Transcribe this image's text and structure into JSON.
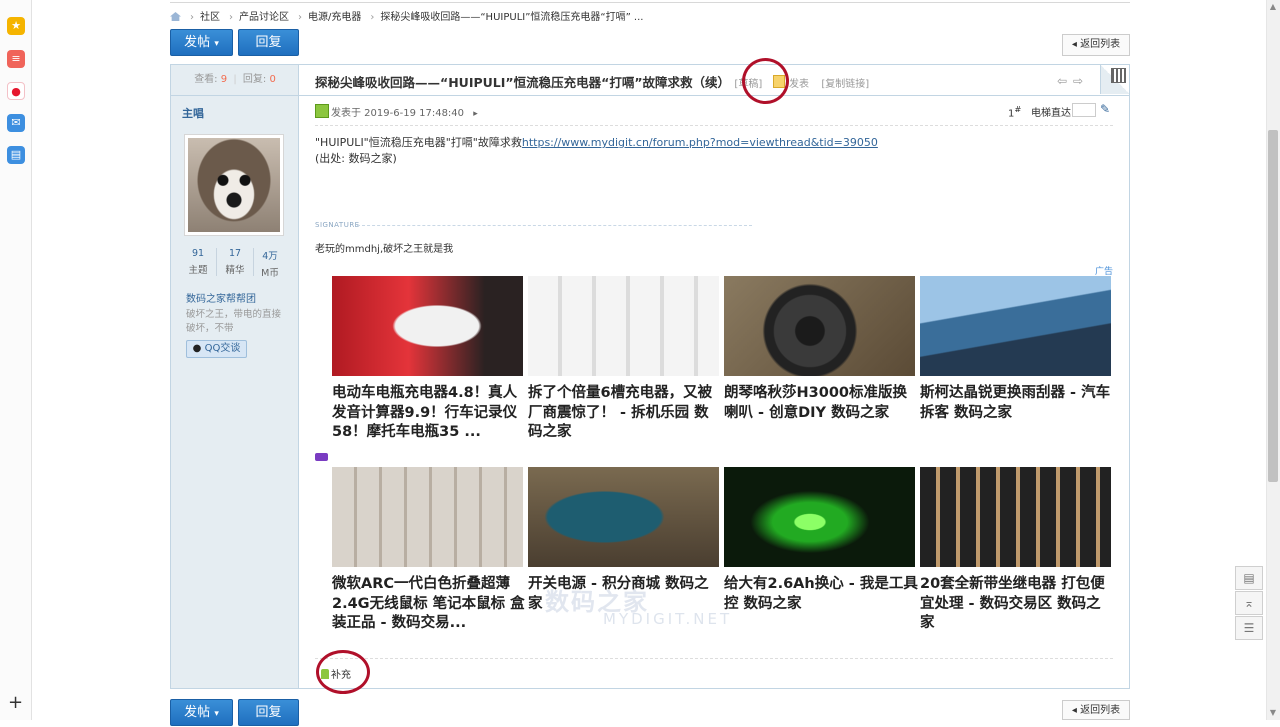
{
  "browser_sidebar": {
    "icons": [
      {
        "name": "favorites-star-icon",
        "color": "#f5b400",
        "glyph": "★"
      },
      {
        "name": "notes-icon",
        "color": "#f0645a",
        "glyph": "≡"
      },
      {
        "name": "weibo-icon",
        "color": "#e6162d",
        "glyph": "●"
      },
      {
        "name": "mail-icon",
        "color": "#3d8fe0",
        "glyph": "✉"
      },
      {
        "name": "document-icon",
        "color": "#3d8fe0",
        "glyph": "▤"
      }
    ],
    "add_glyph": "+"
  },
  "breadcrumb": {
    "items": [
      "社区",
      "产品讨论区",
      "电源/充电器",
      "探秘尖峰吸收回路——“HUIPULI”恒流稳压充电器“打嗝” ..."
    ],
    "separator": "›"
  },
  "toolbar": {
    "post_label": "发帖",
    "post_caret": "▾",
    "reply_label": "回复",
    "back_label": "返回列表",
    "back_arrow": "◂"
  },
  "thread": {
    "views_label": "查看:",
    "views": "9",
    "replies_label": "回复:",
    "replies": "0",
    "title": "探秘尖峰吸收回路——“HUIPULI”恒流稳压充电器“打嗝”故障求救（续）",
    "draft_label": "[草稿]",
    "publish_label": "发表",
    "copy_link_label": "[复制链接]",
    "prev_glyph": "⇦",
    "next_glyph": "⇨"
  },
  "author": {
    "role": "主唱",
    "stats": [
      {
        "value": "91",
        "label": "主题"
      },
      {
        "value": "17",
        "label": "精华"
      },
      {
        "value": "4万",
        "label": "M币"
      }
    ],
    "group": "数码之家帮帮团",
    "signature_short": "破坏之王，带电的直接破坏，不带",
    "qq_label": "QQ交谈"
  },
  "post": {
    "posted_at": "发表于 2019-6-19 17:48:40",
    "posted_arrow": "▸",
    "floor": "1",
    "floor_suffix": "#",
    "jump_label": "电梯直达",
    "content_line1": "\"HUIPULI\"恒流稳压充电器\"打嗝\"故障求救",
    "content_link": "https://www.mydigit.cn/forum.php?mod=viewthread&tid=39050",
    "content_line2": "(出处: 数码之家)",
    "signature_label": "SIGNATURE",
    "signature": "老玩的mmdhj,破坏之王就是我",
    "ad_label": "广告",
    "supplement_label": "补充"
  },
  "ads": [
    {
      "text": "电动车电瓶充电器4.8！真人发音计算器9.9！行车记录仪58！摩托车电瓶35 ...",
      "img": "arm-sleeve"
    },
    {
      "text": "拆了个倍量6槽充电器，又被厂商震惊了！ - 拆机乐园 数码之家",
      "img": "charger"
    },
    {
      "text": "朗琴咯秋莎H3000标准版换喇叭 - 创意DIY 数码之家",
      "img": "speaker"
    },
    {
      "text": "斯柯达晶锐更换雨刮器 - 汽车拆客 数码之家",
      "img": "wiper"
    },
    {
      "text": "微软ARC一代白色折叠超薄2.4G无线鼠标 笔记本鼠标 盒装正品 - 数码交易...",
      "img": "mouse-boxes"
    },
    {
      "text": "开关电源 - 积分商城 数码之家",
      "img": "cables"
    },
    {
      "text": "给大有2.6Ah换心 - 我是工具控 数码之家",
      "img": "green-led"
    },
    {
      "text": "20套全新带坐继电器 打包便宜处理 - 数码交易区 数码之家",
      "img": "relays"
    }
  ],
  "watermark": {
    "line1": "数码之家",
    "line2": "MYDIGIT.NET"
  },
  "float_tools": [
    {
      "name": "comment-tool-icon",
      "glyph": "▤"
    },
    {
      "name": "back-to-top-icon",
      "glyph": "⌅"
    },
    {
      "name": "list-tool-icon",
      "glyph": "☰"
    }
  ]
}
